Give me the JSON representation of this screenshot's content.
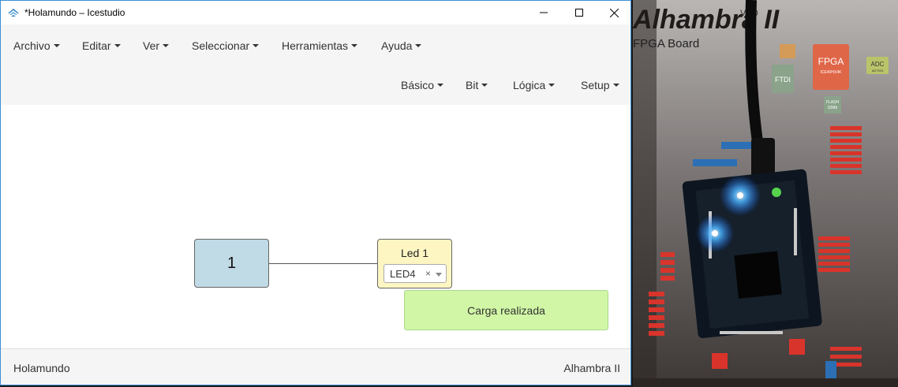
{
  "window": {
    "title": "*Holamundo – Icestudio"
  },
  "menubar": {
    "top": [
      {
        "label": "Archivo"
      },
      {
        "label": "Editar"
      },
      {
        "label": "Ver"
      },
      {
        "label": "Seleccionar"
      },
      {
        "label": "Herramientas"
      },
      {
        "label": "Ayuda"
      }
    ],
    "blocks": [
      {
        "label": "Básico"
      },
      {
        "label": "Bit"
      },
      {
        "label": "Lógica"
      },
      {
        "label": "Setup"
      }
    ]
  },
  "canvas": {
    "const_block": {
      "value": "1"
    },
    "led_block": {
      "title": "Led 1",
      "selected": "LED4",
      "clear": "×"
    },
    "notification": "Carga realizada"
  },
  "footer": {
    "project": "Holamundo",
    "board": "Alhambra II"
  },
  "photo": {
    "board_title": "Alhambra II",
    "version": "V1.0",
    "subtitle": "FPGA Board",
    "fpga_label": "FPGA",
    "fpga_chip": "ICE40HX4K",
    "ftdi_label": "FTDI",
    "adc_label": "ADC",
    "adc_chip": "AD7924",
    "flash_label": "FLASH",
    "flash_size": "32Mb"
  },
  "colors": {
    "accent": "#3c8fd6",
    "const_block": "#c0dae6",
    "led_block": "#fdf6c3",
    "toast": "#d1f7a6"
  }
}
